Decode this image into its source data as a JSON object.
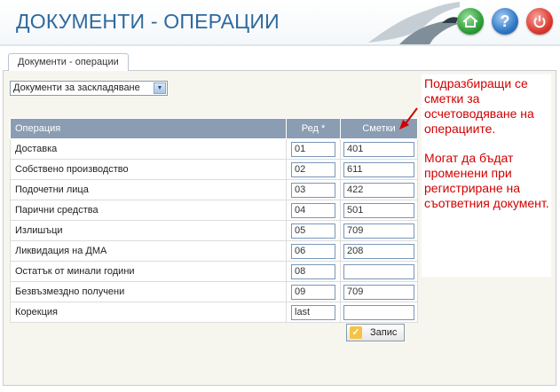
{
  "header": {
    "title": "ДОКУМЕНТИ - ОПЕРАЦИИ"
  },
  "icons": {
    "home": "home-icon",
    "help": "help-icon",
    "power": "power-icon"
  },
  "tab": {
    "label": "Документи - операции"
  },
  "filter": {
    "selected": "Документи за заскладяване"
  },
  "table": {
    "headers": {
      "operation": "Операция",
      "order": "Ред *",
      "accounts": "Сметки"
    },
    "rows": [
      {
        "operation": "Доставка",
        "order": "01",
        "account": "401"
      },
      {
        "operation": "Собствено производство",
        "order": "02",
        "account": "611"
      },
      {
        "operation": "Подочетни лица",
        "order": "03",
        "account": "422"
      },
      {
        "operation": "Парични средства",
        "order": "04",
        "account": "501"
      },
      {
        "operation": "Излишъци",
        "order": "05",
        "account": "709"
      },
      {
        "operation": "Ликвидация на ДМА",
        "order": "06",
        "account": "208"
      },
      {
        "operation": "Остатък от минали години",
        "order": "08",
        "account": ""
      },
      {
        "operation": "Безвъзмездно получени",
        "order": "09",
        "account": "709"
      },
      {
        "operation": "Корекция",
        "order": "last",
        "account": ""
      }
    ]
  },
  "save": {
    "label": "Запис"
  },
  "note": {
    "p1": "Подразбиращи се сметки за осчетоводяване на операциите.",
    "p2": "Могат да бъдат променени при регистриране на съответния документ."
  },
  "colors": {
    "title": "#2e6a9e",
    "table_header": "#8a9db2",
    "note": "#d10000",
    "panel": "#f7f6ee"
  }
}
